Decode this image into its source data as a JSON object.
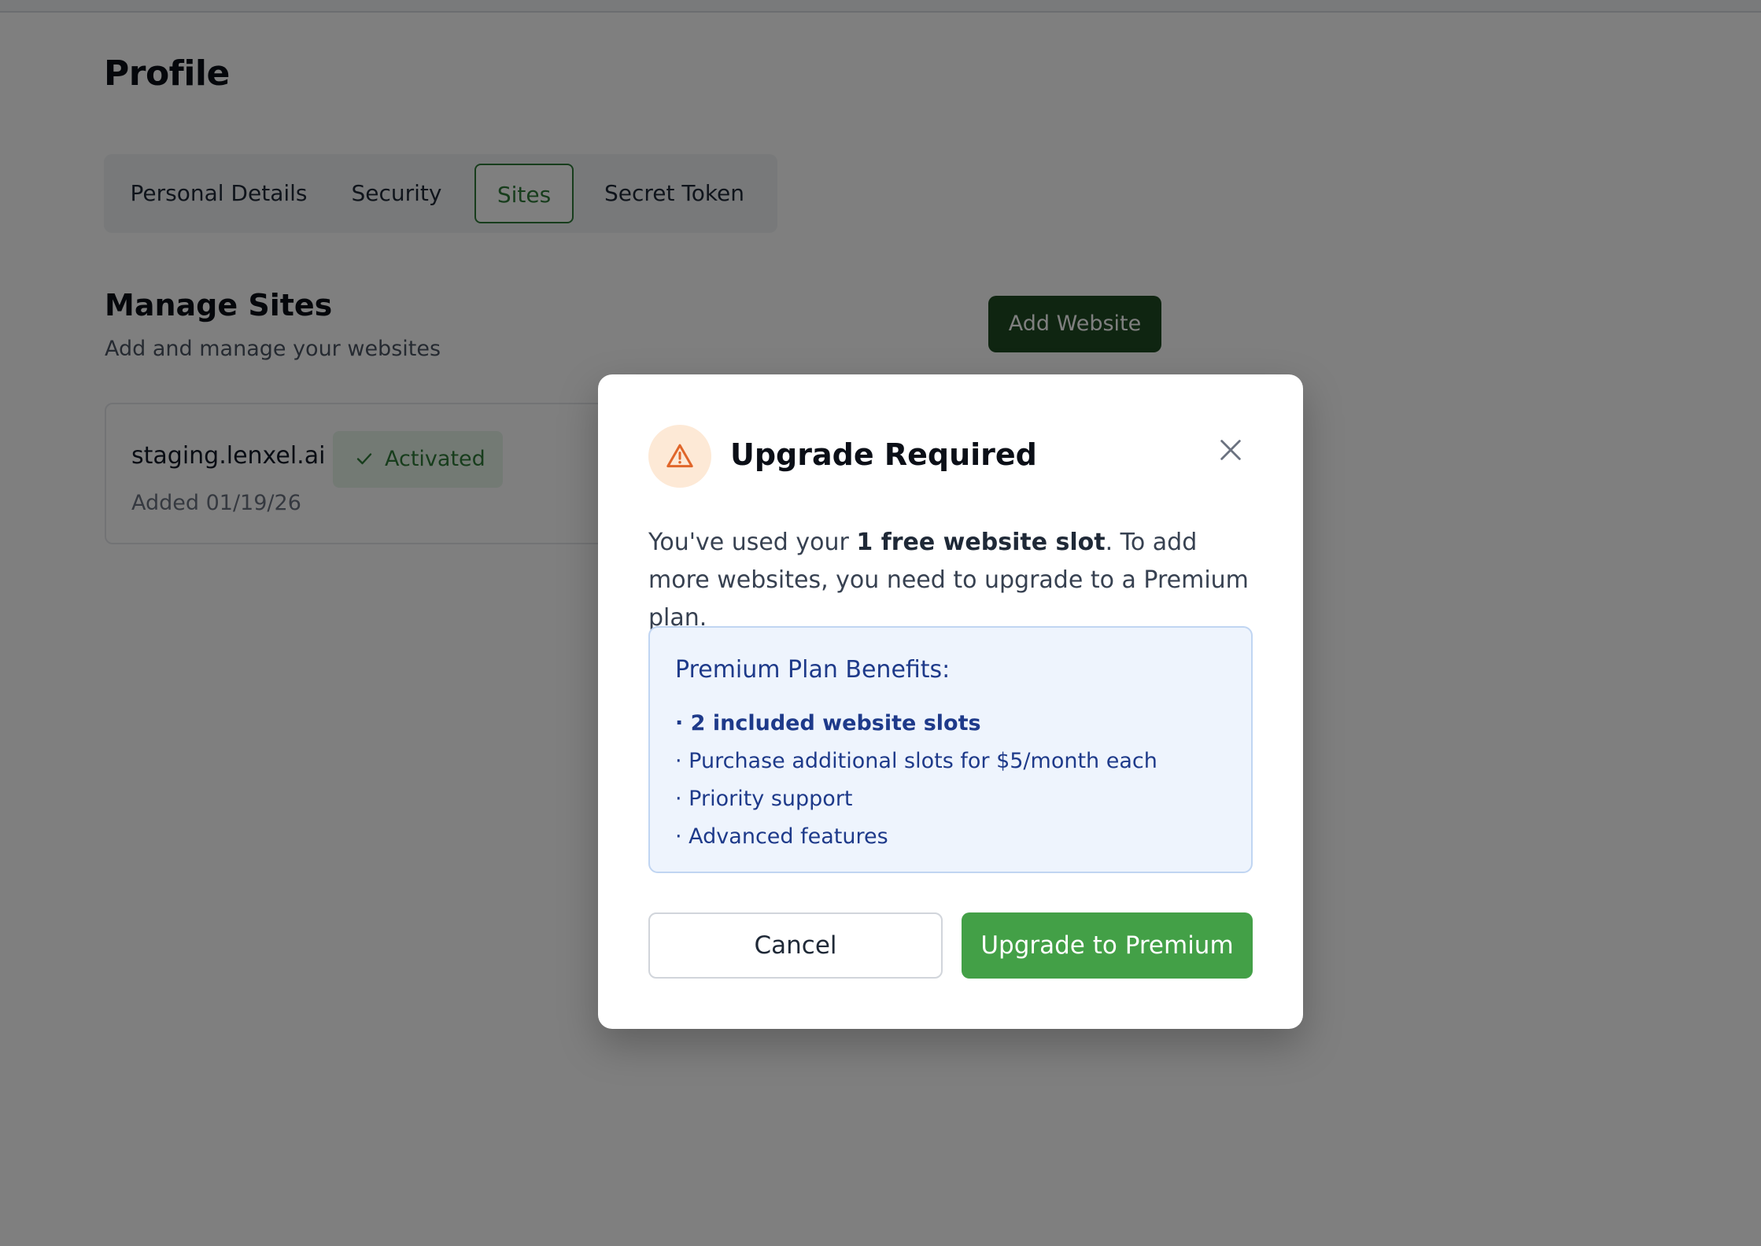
{
  "page": {
    "title": "Profile"
  },
  "tabs": [
    {
      "label": "Personal Details",
      "active": false
    },
    {
      "label": "Security",
      "active": false
    },
    {
      "label": "Sites",
      "active": true
    },
    {
      "label": "Secret Token",
      "active": false
    }
  ],
  "manage_sites": {
    "title": "Manage Sites",
    "subtitle": "Add and manage your websites",
    "add_button_label": "Add Website",
    "sites": [
      {
        "domain": "staging.lenxel.ai",
        "status": "Activated",
        "status_icon": "checkmark-icon",
        "added": "Added 01/19/26"
      }
    ]
  },
  "modal": {
    "title": "Upgrade Required",
    "icon": "warning-triangle-icon",
    "close_icon": "close-icon",
    "message_prefix": "You've used your ",
    "message_bold": "1 free website slot",
    "message_suffix": ". To add more websites, you need to upgrade to a Premium plan.",
    "benefits_title": "Premium Plan Benefits:",
    "benefits": [
      "2 included website slots",
      "Purchase additional slots for $5/month each",
      "Priority support",
      "Advanced features"
    ],
    "cancel_label": "Cancel",
    "upgrade_label": "Upgrade to Premium"
  },
  "colors": {
    "accent_green": "#43a047",
    "dark_green": "#1f4a23",
    "active_tab_green": "#2f7a38",
    "benefits_bg": "#eef4fd",
    "benefits_text": "#1e3a8a",
    "warning_orange": "#e0662a",
    "overlay": "rgba(0,0,0,0.5)"
  }
}
